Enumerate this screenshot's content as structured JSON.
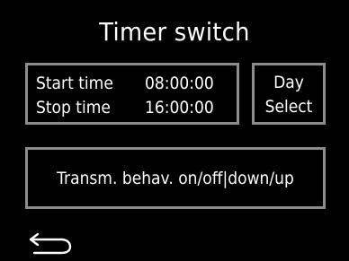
{
  "screen": {
    "title": "Timer switch",
    "background_color": "#000000",
    "border_color": "#8c8c8c",
    "text_color": "#ffffff"
  },
  "times": {
    "start_label": "Start time",
    "start_value": "08:00:00",
    "stop_label": "Stop time",
    "stop_value": "16:00:00"
  },
  "day_select": {
    "line1": "Day",
    "line2": "Select"
  },
  "transmission": {
    "label": "Transm. behav. on/off|down/up"
  },
  "navigation": {
    "back_icon": "back-arrow-icon"
  }
}
